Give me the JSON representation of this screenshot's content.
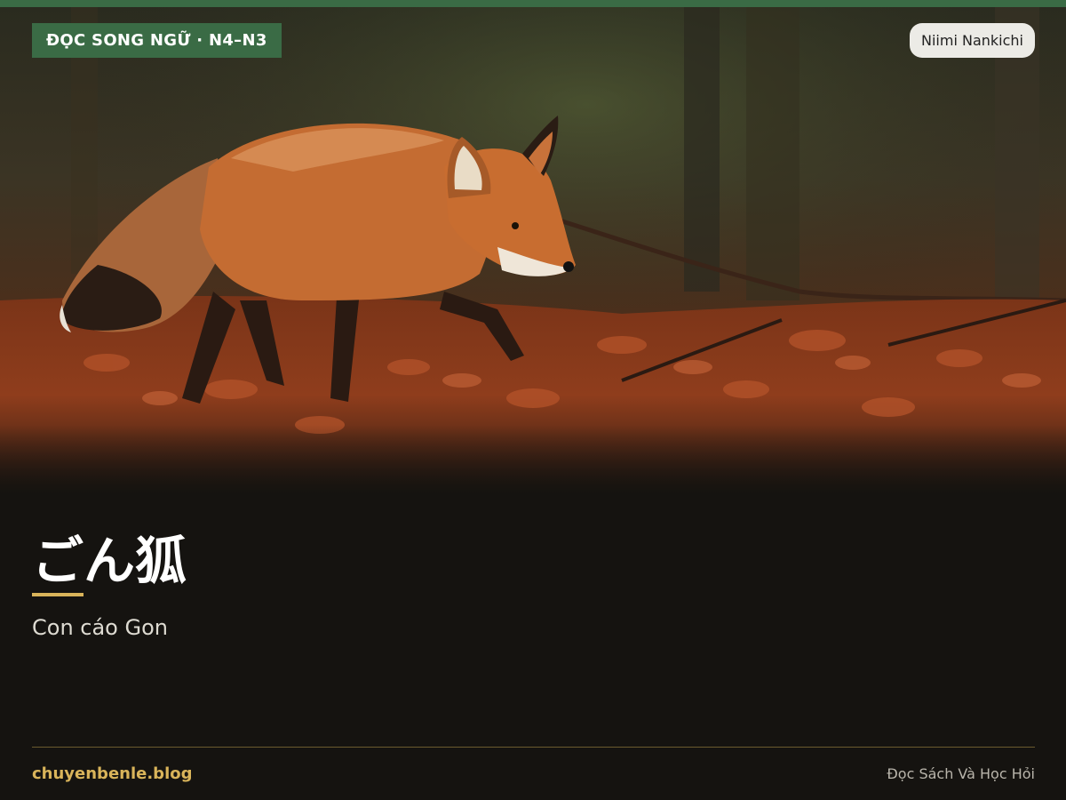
{
  "badge": {
    "label": "ĐỌC SONG NGỮ · N4–N3"
  },
  "author": {
    "name": "Niimi Nankichi"
  },
  "story": {
    "title_jp": "ごん狐",
    "title_vi": "Con cáo Gon"
  },
  "footer": {
    "site": "chuyenbenle.blog",
    "tagline": "Đọc Sách Và Học Hỏi"
  },
  "hero_image": {
    "subject": "fox-walking-on-autumn-leaves"
  },
  "colors": {
    "accent_green": "#3a6b45",
    "accent_gold": "#d9b45a",
    "background": "#151310"
  }
}
